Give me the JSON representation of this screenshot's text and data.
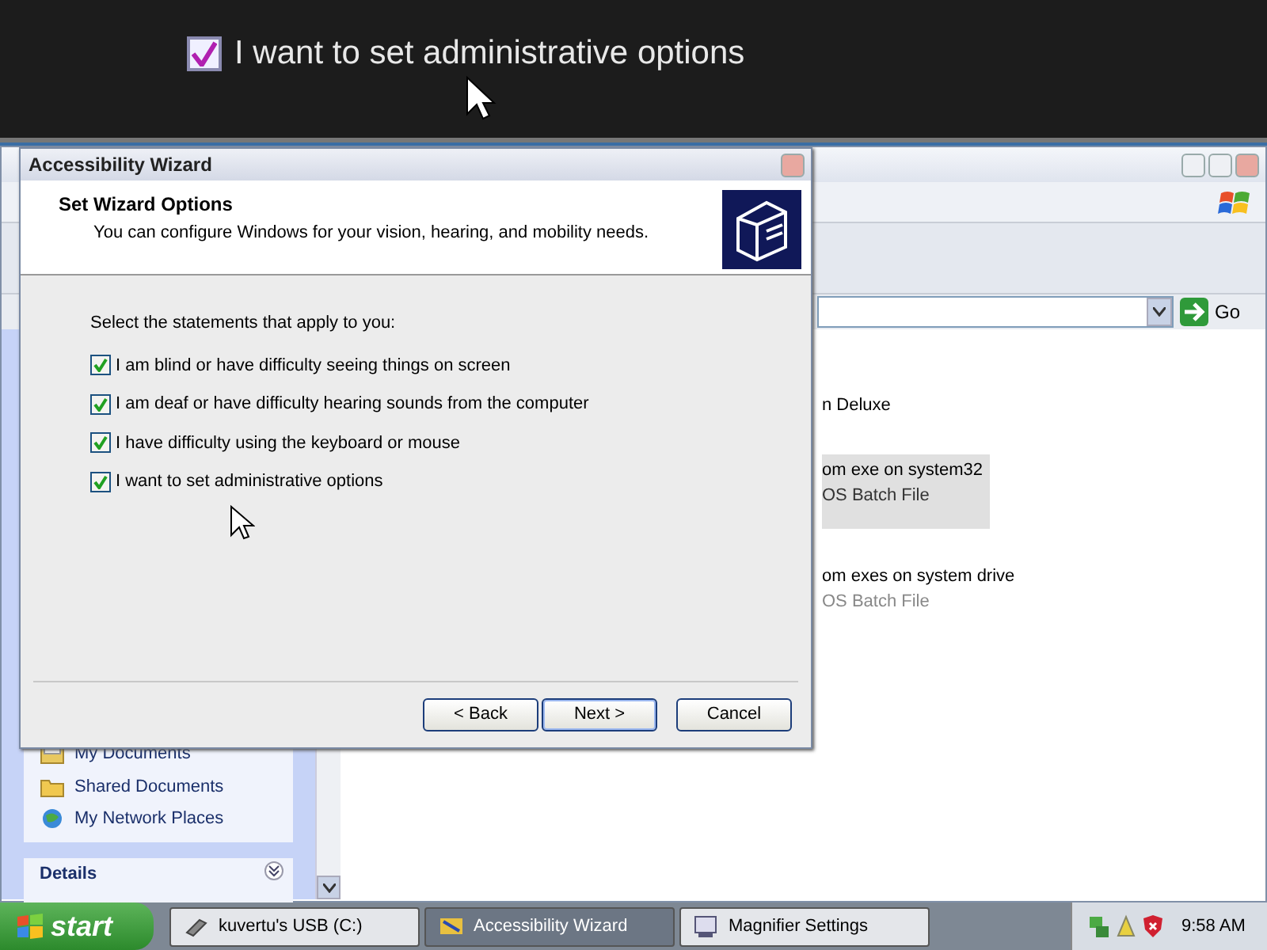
{
  "magnifier": {
    "option": {
      "label": "I want to set administrative options",
      "checked": true
    }
  },
  "explorer": {
    "go": "Go",
    "items": [
      {
        "line1": "n Deluxe",
        "selected": false
      },
      {
        "line1": "om exe on system32",
        "line2": "OS Batch File",
        "selected": true
      },
      {
        "line1": "om exes on system drive",
        "line2": "OS Batch File",
        "selected": false
      }
    ],
    "places": [
      "My Documents",
      "Shared Documents",
      "My Network Places"
    ],
    "details_title": "Details"
  },
  "wizard": {
    "title": "Accessibility Wizard",
    "heading": "Set Wizard Options",
    "subheading": "You can configure Windows for your vision, hearing, and mobility needs.",
    "prompt": "Select the statements that apply to you:",
    "options": [
      {
        "label": "I am blind or have difficulty seeing things on screen",
        "checked": true
      },
      {
        "label": "I am deaf or have difficulty hearing sounds from the computer",
        "checked": true
      },
      {
        "label": "I have difficulty using the keyboard or mouse",
        "checked": true
      },
      {
        "label": "I want to set administrative options",
        "checked": true
      }
    ],
    "buttons": [
      "< Back",
      "Next >",
      "Cancel"
    ]
  },
  "taskbar": {
    "start": "start",
    "tasks": [
      {
        "label": "kuvertu's USB (C:)",
        "selected": false
      },
      {
        "label": "Accessibility Wizard",
        "selected": true
      },
      {
        "label": "Magnifier Settings",
        "selected": false
      }
    ],
    "clock": "9:58 AM"
  }
}
